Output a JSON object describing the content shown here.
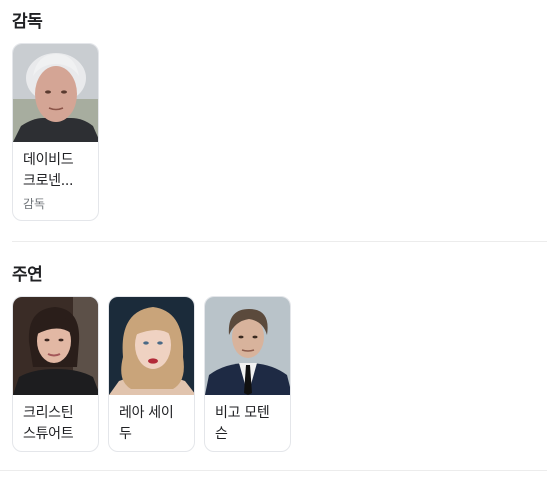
{
  "director_section": {
    "title": "감독",
    "people": [
      {
        "name_line1": "데이비드",
        "name_line2": "크로넨...",
        "role": "감독"
      }
    ]
  },
  "cast_section": {
    "title": "주연",
    "people": [
      {
        "name_line1": "크리스틴",
        "name_line2": "스튜어트"
      },
      {
        "name_line1": "레아 세이",
        "name_line2": "두"
      },
      {
        "name_line1": "비고 모텐",
        "name_line2": "슨"
      }
    ]
  }
}
